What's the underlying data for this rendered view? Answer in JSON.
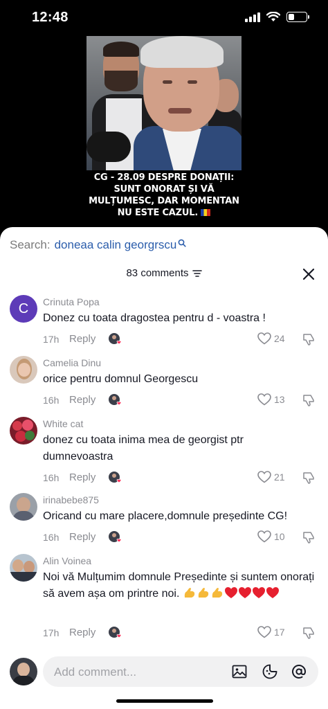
{
  "status_bar": {
    "time": "12:48",
    "battery_level": 0.35
  },
  "video": {
    "caption_lines": [
      "CG - 28.09 DESPRE DONAȚII:",
      "SUNT ONORAT ȘI VĂ",
      "MULȚUMESC, DAR MOMENTAN",
      "NU ESTE CAZUL."
    ],
    "caption_flag": "romania-flag"
  },
  "search": {
    "label": "Search:",
    "query": "doneaa calin georgrscu"
  },
  "comments_header": {
    "count_label": "83 comments"
  },
  "comments": [
    {
      "name": "Crinuta Popa",
      "avatar_letter": "C",
      "text": "Donez cu toata dragostea pentru d - voastra !",
      "time": "17h",
      "reply": "Reply",
      "likes": "24"
    },
    {
      "name": "Camelia Dinu",
      "text": "orice pentru domnul Georgescu",
      "time": "16h",
      "reply": "Reply",
      "likes": "13"
    },
    {
      "name": "White cat",
      "text": "donez cu toata inima mea de georgist ptr dumnevoastra",
      "time": "16h",
      "reply": "Reply",
      "likes": "21"
    },
    {
      "name": "irinabebe875",
      "text": "Oricand cu mare placere,domnule președinte CG!",
      "time": "16h",
      "reply": "Reply",
      "likes": "10"
    },
    {
      "name": "Alin Voinea",
      "text": "Noi vă Mulțumim domnule Președinte și suntem onorați să avem așa om printre noi.",
      "time": "17h",
      "reply": "Reply",
      "likes": "17"
    }
  ],
  "comment_input": {
    "placeholder": "Add comment..."
  },
  "colors": {
    "accent_link": "#2b5dab",
    "avatar_purple": "#5d3bb8",
    "text_primary": "#161823",
    "text_secondary": "#8a8b91"
  }
}
